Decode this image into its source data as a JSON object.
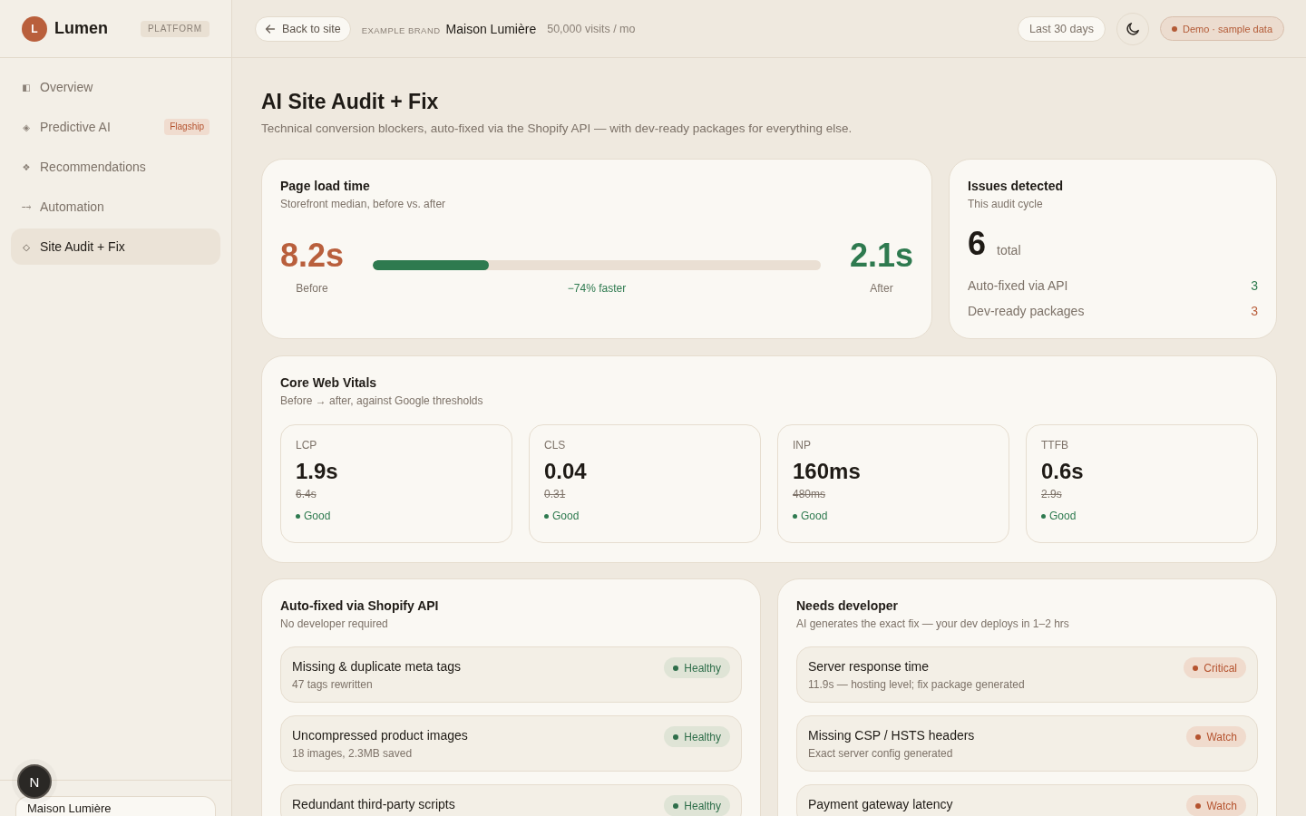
{
  "sidebar": {
    "logo": {
      "initial": "L",
      "name": "Lumen",
      "badge": "PLATFORM"
    },
    "nav": [
      {
        "icon": "◧",
        "label": "Overview",
        "selected": false
      },
      {
        "icon": "◈",
        "label": "Predictive AI",
        "badge": "Flagship",
        "selected": false
      },
      {
        "icon": "❖",
        "label": "Recommendations",
        "selected": false
      },
      {
        "icon": "⤍",
        "label": "Automation",
        "selected": false
      },
      {
        "icon": "◇",
        "label": "Site Audit + Fix",
        "selected": true
      }
    ],
    "footer": {
      "store": "Maison Lumière"
    }
  },
  "dev_badge": {
    "label": "N"
  },
  "header": {
    "back_button": "Back to site",
    "brand_label": "EXAMPLE BRAND",
    "brand_name": "Maison Lumière",
    "traffic": "50,000 visits / mo",
    "date_range": "Last 30 days",
    "demo_badge": "Demo · sample data"
  },
  "page": {
    "title": "AI Site Audit + Fix",
    "subtitle": "Technical conversion blockers, auto-fixed via the Shopify API — with dev-ready packages for everything else."
  },
  "load_time": {
    "title": "Page load time",
    "subtitle": "Storefront median, before vs. after",
    "before": {
      "value": "8.2s",
      "label": "Before"
    },
    "after": {
      "value": "2.1s",
      "label": "After"
    },
    "level": 0.26,
    "change": "−74% faster"
  },
  "issues": {
    "title": "Issues detected",
    "subtitle": "This audit cycle",
    "count": "6",
    "count_label": "total",
    "rows": [
      {
        "label": "Auto-fixed via API",
        "value": "3",
        "kind": "fixed"
      },
      {
        "label": "Dev-ready packages",
        "value": "3",
        "kind": "dev"
      }
    ]
  },
  "vitals": {
    "title": "Core Web Vitals",
    "subtitle": "Before → after, against Google thresholds",
    "metrics": [
      {
        "name": "LCP",
        "value": "1.9s",
        "previous": "6.4s",
        "status": "Good",
        "kind": "good"
      },
      {
        "name": "CLS",
        "value": "0.04",
        "previous": "0.31",
        "status": "Good",
        "kind": "good"
      },
      {
        "name": "INP",
        "value": "160ms",
        "previous": "480ms",
        "status": "Good",
        "kind": "good"
      },
      {
        "name": "TTFB",
        "value": "0.6s",
        "previous": "2.9s",
        "status": "Good",
        "kind": "good"
      }
    ]
  },
  "auto_fixed": {
    "title": "Auto-fixed via Shopify API",
    "subtitle": "No developer required",
    "items": [
      {
        "title": "Missing & duplicate meta tags",
        "detail": "47 tags rewritten",
        "status": "Healthy",
        "kind": "healthy"
      },
      {
        "title": "Uncompressed product images",
        "detail": "18 images, 2.3MB saved",
        "status": "Healthy",
        "kind": "healthy"
      },
      {
        "title": "Redundant third-party scripts",
        "status": "Healthy",
        "kind": "healthy"
      }
    ]
  },
  "needs_developer": {
    "title": "Needs developer",
    "subtitle": "AI generates the exact fix — your dev deploys in 1–2 hrs",
    "items": [
      {
        "title": "Server response time",
        "detail": "11.9s — hosting level; fix package generated",
        "status": "Critical",
        "kind": "warning"
      },
      {
        "title": "Missing CSP / HSTS headers",
        "detail": "Exact server config generated",
        "status": "Watch",
        "kind": "warning"
      },
      {
        "title": "Payment gateway latency",
        "status": "Watch",
        "kind": "warning"
      }
    ]
  }
}
